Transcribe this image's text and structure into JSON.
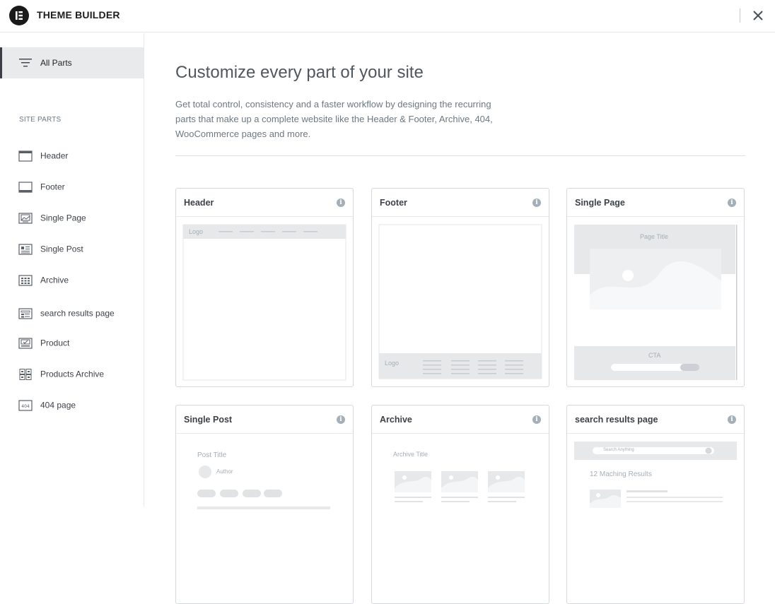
{
  "app": {
    "title": "THEME BUILDER"
  },
  "sidebar": {
    "all_parts_label": "All Parts",
    "section_heading": "SITE PARTS",
    "items": [
      {
        "label": "Header",
        "icon": "header-icon"
      },
      {
        "label": "Footer",
        "icon": "footer-icon"
      },
      {
        "label": "Single Page",
        "icon": "single-page-icon"
      },
      {
        "label": "Single Post",
        "icon": "single-post-icon"
      },
      {
        "label": "Archive",
        "icon": "archive-icon"
      },
      {
        "label": "search results page",
        "icon": "search-results-icon"
      },
      {
        "label": "Product",
        "icon": "product-icon"
      },
      {
        "label": "Products Archive",
        "icon": "products-archive-icon"
      },
      {
        "label": "404 page",
        "icon": "404-icon"
      }
    ]
  },
  "main": {
    "heading": "Customize every part of your site",
    "intro": "Get total control, consistency and a faster workflow by designing the recurring parts that make up a complete website like the Header & Footer, Archive, 404, WooCommerce pages and more.",
    "cards": [
      {
        "title": "Header",
        "preview_text": [
          "Logo"
        ]
      },
      {
        "title": "Footer",
        "preview_text": [
          "Logo"
        ]
      },
      {
        "title": "Single Page",
        "preview_text": [
          "Page Title",
          "CTA"
        ]
      },
      {
        "title": "Single Post",
        "preview_text": [
          "Post Title",
          "Author"
        ]
      },
      {
        "title": "Archive",
        "preview_text": [
          "Archive Title"
        ]
      },
      {
        "title": "search results page",
        "preview_text": [
          "Search Anything",
          "12 Maching Results"
        ]
      }
    ],
    "info_glyph": "i"
  },
  "colors": {
    "accent_dark": "#1a1a1a",
    "wireframe": "#e6e8ea",
    "wireframe_dark": "#d5d8dc",
    "selected_bg": "#e9eaec"
  }
}
